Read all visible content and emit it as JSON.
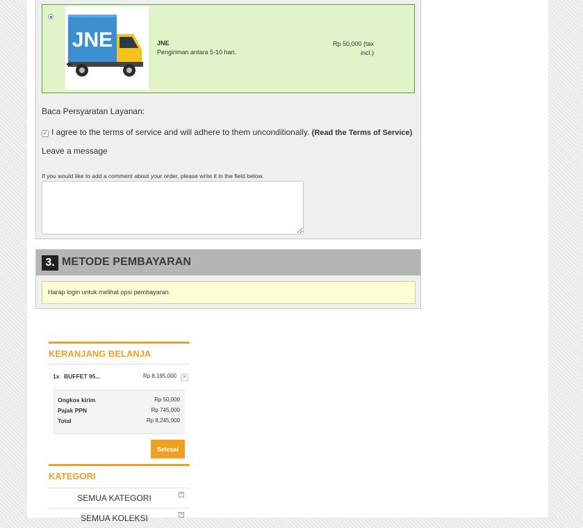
{
  "shipping": {
    "carrier": {
      "logo_text": "JNE",
      "name": "JNE",
      "delay": "Pengiriman antara 5-10 hari.",
      "price_line1": "Rp 50,000 (tax",
      "price_line2": "incl.)",
      "selected": true
    },
    "tos_heading": "Baca Persyaratan Layanan:",
    "tos_text": "I agree to the terms of service and will adhere to them unconditionally.",
    "tos_link": "(Read the Terms of Service)",
    "tos_checked": true,
    "message_heading": "Leave a message",
    "message_hint": "If you would like to add a comment about your order, please write it in the field below.",
    "message_value": ""
  },
  "payment": {
    "step_number": "3.",
    "title": "METODE PEMBAYARAN",
    "notice": "Harap login untuk melihat opsi pembayaran."
  },
  "cart": {
    "title": "KERANJANG BELANJA",
    "item": {
      "qty": "1x",
      "name": "BUFFET 95...",
      "price": "Rp 8,195,000",
      "remove_icon": "×"
    },
    "totals": [
      {
        "label": "Ongkos kirim",
        "value": "Rp 50,000"
      },
      {
        "label": "Pajak PPN",
        "value": "Rp 745,000"
      },
      {
        "label": "Total",
        "value": "Rp 8,245,000"
      }
    ],
    "checkout_label": "Selesai"
  },
  "categories": {
    "title": "KATEGORI",
    "items": [
      {
        "label": "SEMUA KATEGORI"
      },
      {
        "label": "SEMUA KOLEKSI"
      }
    ]
  },
  "colors": {
    "accent": "#f0a020",
    "carrier_bg": "#e1f3c9",
    "carrier_border": "#5aa140",
    "notice_bg": "#fefed6"
  }
}
